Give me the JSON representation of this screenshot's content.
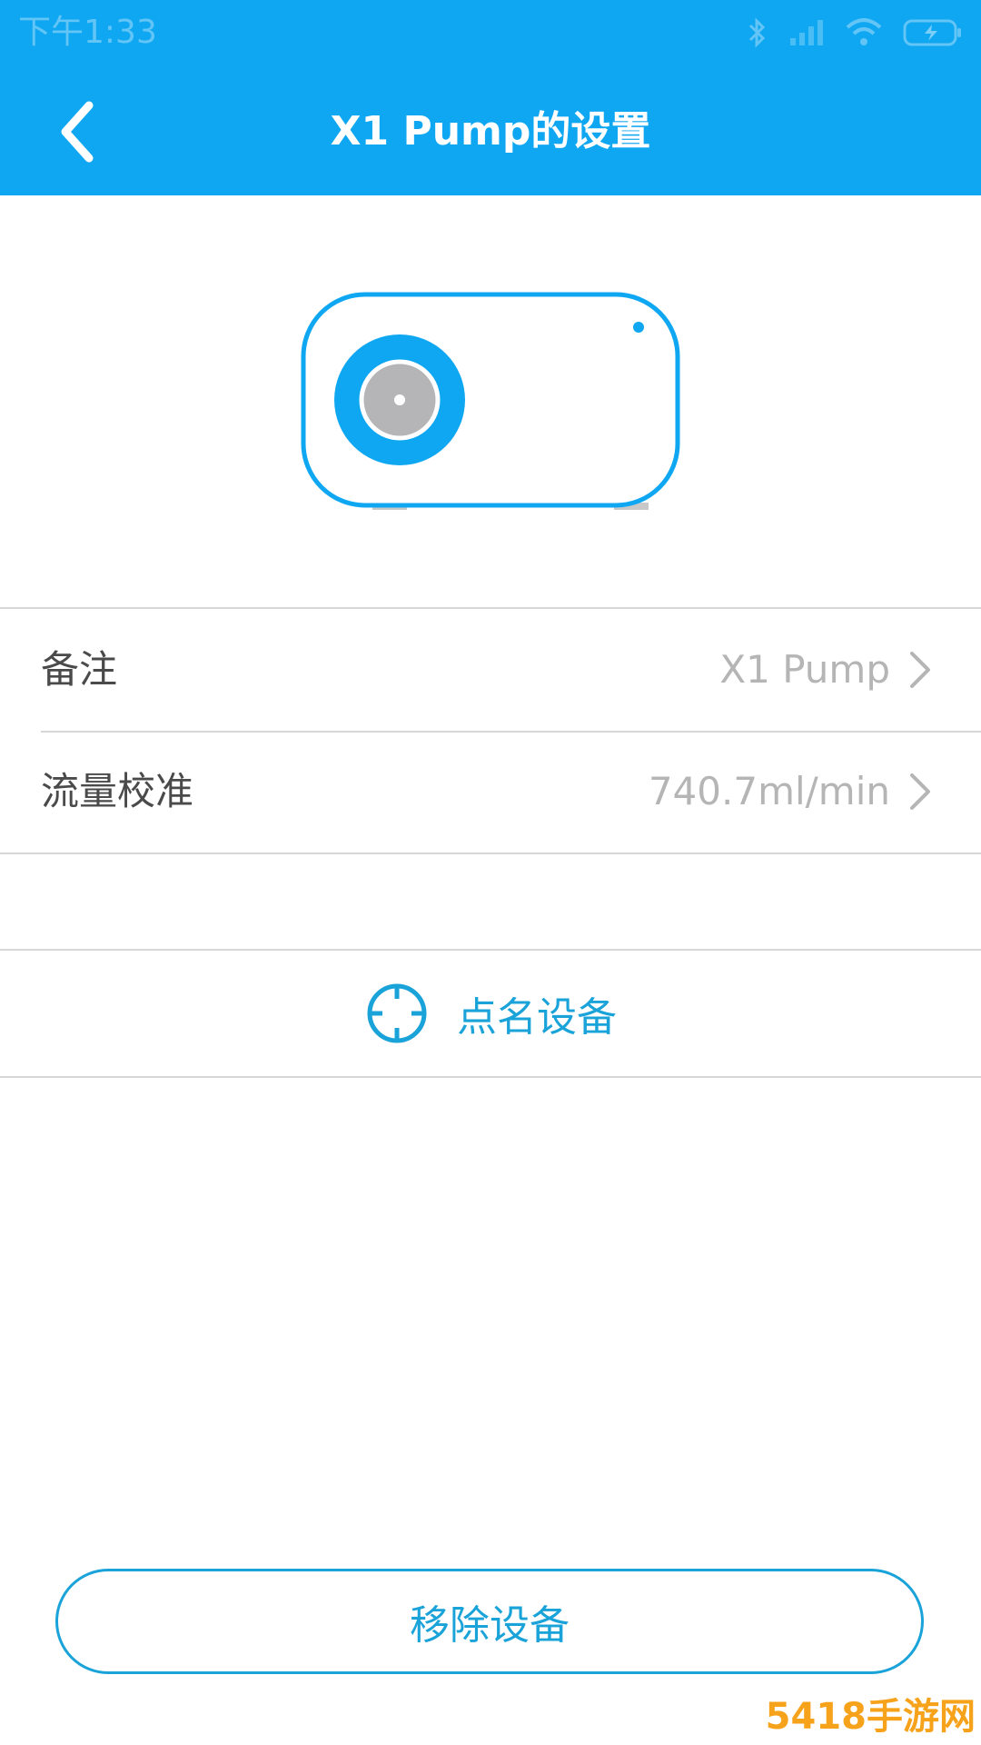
{
  "status_bar": {
    "time": "下午1:33",
    "icons": [
      "bluetooth-icon",
      "signal-icon",
      "wifi-icon",
      "battery-icon"
    ]
  },
  "header": {
    "title": "X1 Pump的设置",
    "back_icon": "chevron-left-icon"
  },
  "device": {
    "illustration": "pump-device-icon"
  },
  "settings": {
    "items": [
      {
        "label": "备注",
        "value": "X1 Pump"
      },
      {
        "label": "流量校准",
        "value": "740.7ml/min"
      }
    ]
  },
  "identify": {
    "label": "点名设备",
    "icon": "crosshair-icon"
  },
  "footer": {
    "remove_label": "移除设备"
  },
  "watermark": {
    "text": "5418手游网"
  },
  "colors": {
    "primary": "#0fa7f2",
    "accent": "#1aa3d9",
    "text": "#4a4a4a",
    "muted": "#b5b5b5",
    "divider": "#d7d7d7"
  }
}
